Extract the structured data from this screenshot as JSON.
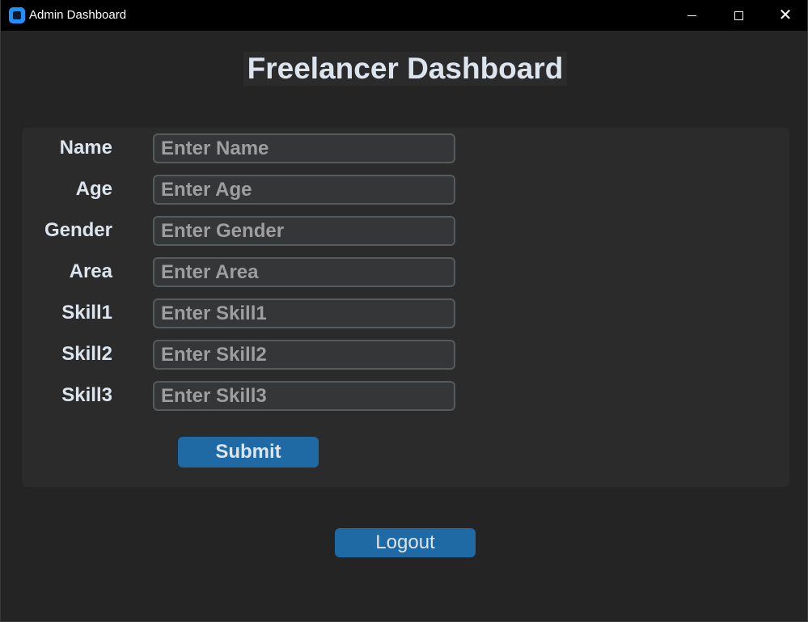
{
  "window": {
    "title": "Admin Dashboard",
    "minimize_icon": "minimize-icon",
    "maximize_icon": "maximize-icon",
    "close_icon": "close-icon",
    "close_glyph": "✕"
  },
  "heading": "Freelancer Dashboard",
  "form": {
    "fields": [
      {
        "label": "Name",
        "placeholder": "Enter Name",
        "value": ""
      },
      {
        "label": "Age",
        "placeholder": "Enter Age",
        "value": ""
      },
      {
        "label": "Gender",
        "placeholder": "Enter Gender",
        "value": ""
      },
      {
        "label": "Area",
        "placeholder": "Enter Area",
        "value": ""
      },
      {
        "label": "Skill1",
        "placeholder": "Enter Skill1",
        "value": ""
      },
      {
        "label": "Skill2",
        "placeholder": "Enter Skill2",
        "value": ""
      },
      {
        "label": "Skill3",
        "placeholder": "Enter Skill3",
        "value": ""
      }
    ],
    "submit_label": "Submit"
  },
  "logout_label": "Logout",
  "colors": {
    "background": "#242424",
    "panel": "#2b2b2b",
    "accent": "#1f6aa5",
    "input_bg": "#343638",
    "input_border": "#565b5e",
    "text": "#dce4ee"
  }
}
